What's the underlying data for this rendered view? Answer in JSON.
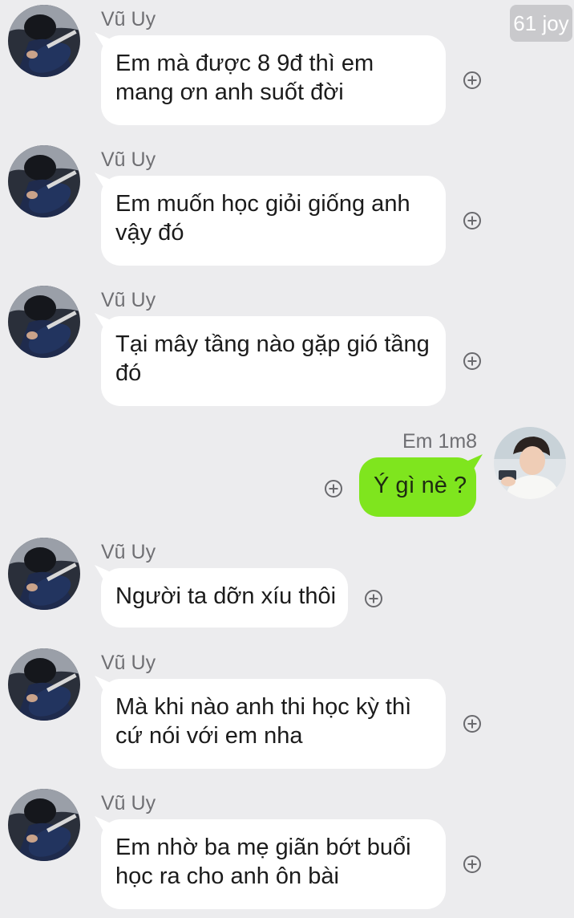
{
  "chat": {
    "badge": "61 joy",
    "messages": [
      {
        "sender": "Vũ Uy",
        "lines": [
          "Em mà được 8 9đ thì em",
          "mang ơn anh suốt đời"
        ]
      },
      {
        "sender": "Vũ Uy",
        "lines": [
          "Em muốn học giỏi giống anh",
          "vậy đó"
        ]
      },
      {
        "sender": "Vũ Uy",
        "lines": [
          "Tại mây tầng nào gặp gió tầng",
          "đó"
        ]
      },
      {
        "sender": "Em 1m8",
        "lines": [
          "Ý gì nè ?"
        ],
        "outgoing": true
      },
      {
        "sender": "Vũ Uy",
        "lines": [
          "Người ta dỡn xíu thôi"
        ]
      },
      {
        "sender": "Vũ Uy",
        "lines": [
          "Mà khi nào anh thi học kỳ thì",
          "cứ nói với em nha"
        ]
      },
      {
        "sender": "Vũ Uy",
        "lines": [
          "Em nhờ ba mẹ giãn bớt buổi",
          "học ra cho anh ôn bài"
        ]
      }
    ]
  },
  "colors": {
    "background": "#ececee",
    "incoming_bubble": "#ffffff",
    "outgoing_bubble": "#7fe51e",
    "sender_text": "#6f6f73"
  },
  "icons": {
    "add": "plus-circle-icon",
    "badge": "joy-counter-badge"
  }
}
